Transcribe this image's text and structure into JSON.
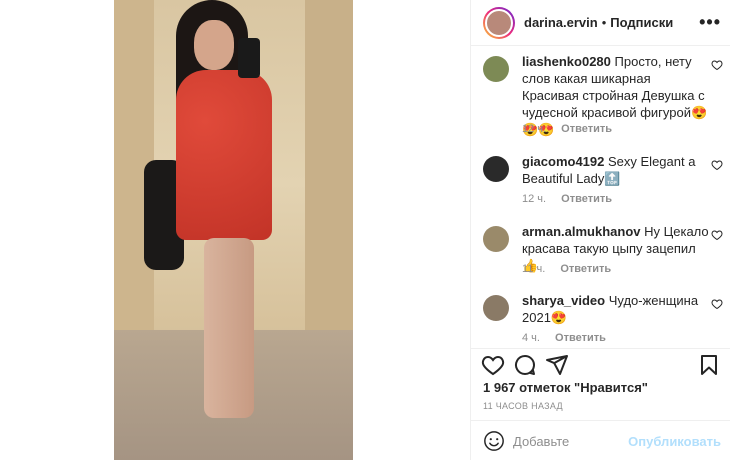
{
  "header": {
    "username": "darina.ervin",
    "separator": "•",
    "follow_label": "Подписки",
    "more_icon": "more-horizontal-icon"
  },
  "comments": [
    {
      "username": "liashenko0280",
      "text": "Просто, нету слов какая шикарная Красивая стройная Девушка с чудесной красивой фигурой😍😍😍",
      "time": "12 ч.",
      "reply_label": "Ответить",
      "avatar_color": "#7d8a55"
    },
    {
      "username": "giacomo4192",
      "text": "Sexy Elegant a Beautiful Lady🔝",
      "time": "12 ч.",
      "reply_label": "Ответить",
      "avatar_color": "#2a2a2a"
    },
    {
      "username": "arman.almukhanov",
      "text": "Ну Цекало красава такую цыпу зацепил👍",
      "time": "11 ч.",
      "reply_label": "Ответить",
      "avatar_color": "#9a8a6a"
    },
    {
      "username": "sharya_video",
      "text": "Чудо-женщина 2021😍",
      "time": "4 ч.",
      "reply_label": "Ответить",
      "avatar_color": "#8a7a66"
    }
  ],
  "actions": {
    "like_icon": "heart-icon",
    "comment_icon": "comment-icon",
    "share_icon": "send-icon",
    "save_icon": "bookmark-icon"
  },
  "likes_text": "1 967 отметок \"Нравится\"",
  "posted_time": "11 ЧАСОВ НАЗАД",
  "add_comment": {
    "placeholder": "Добавьте",
    "publish_label": "Опубликовать",
    "emoji_icon": "smiley-icon"
  },
  "colors": {
    "publish_disabled": "#b2dffc",
    "meta_gray": "#8e8e8e",
    "text": "#262626"
  }
}
